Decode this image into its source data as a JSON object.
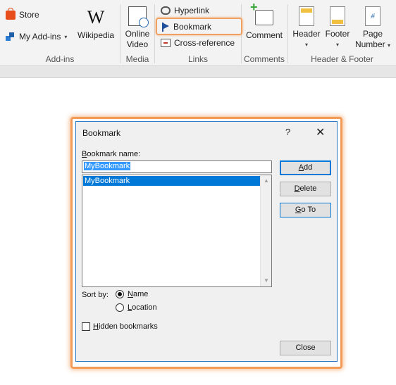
{
  "ribbon": {
    "addins": {
      "store_label": "Store",
      "myaddins_label": "My Add-ins",
      "wikipedia_label": "Wikipedia",
      "wikipedia_glyph": "W",
      "group_label": "Add-ins"
    },
    "media": {
      "online_video_line1": "Online",
      "online_video_line2": "Video",
      "group_label": "Media"
    },
    "links": {
      "hyperlink_label": "Hyperlink",
      "bookmark_label": "Bookmark",
      "crossref_label": "Cross-reference",
      "group_label": "Links"
    },
    "comments": {
      "comment_label": "Comment",
      "group_label": "Comments"
    },
    "header_footer": {
      "header_label": "Header",
      "footer_label": "Footer",
      "page_number_line1": "Page",
      "page_number_line2": "Number",
      "page_number_glyph": "#",
      "group_label": "Header & Footer"
    },
    "caret": "▾"
  },
  "dialog": {
    "title": "Bookmark",
    "help_glyph": "?",
    "close_glyph": "✕",
    "name_label_accel": "B",
    "name_label_rest": "ookmark name:",
    "name_value": "MyBookmark",
    "list_items": [
      "MyBookmark"
    ],
    "scroll_up": "▲",
    "scroll_down": "▼",
    "add_accel": "A",
    "add_rest": "dd",
    "delete_accel": "D",
    "delete_rest": "elete",
    "goto_accel": "G",
    "goto_rest": "o To",
    "sort_by_label": "Sort by:",
    "sort_name_accel": "N",
    "sort_name_rest": "ame",
    "sort_location_accel": "L",
    "sort_location_rest": "ocation",
    "sort_selected": "Name",
    "hidden_accel": "H",
    "hidden_rest": "idden bookmarks",
    "hidden_checked": false,
    "close_label": "Close"
  },
  "colors": {
    "highlight_orange": "#f29a56",
    "selection_blue": "#0078d7",
    "dialog_border": "#2b78c5"
  }
}
